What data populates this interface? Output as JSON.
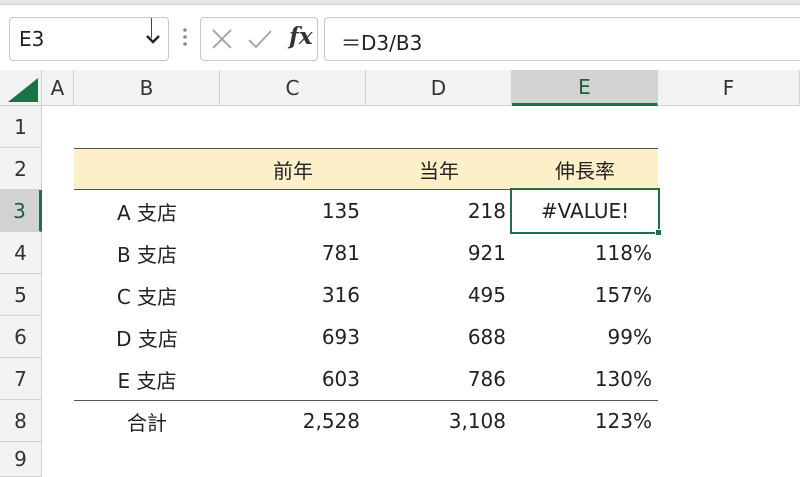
{
  "name_box": {
    "value": "E3"
  },
  "formula_bar": {
    "formula": "＝D3/B3",
    "fx_label": "fx"
  },
  "columns": [
    "A",
    "B",
    "C",
    "D",
    "E",
    "F"
  ],
  "rows": [
    "1",
    "2",
    "3",
    "4",
    "5",
    "6",
    "7",
    "8",
    "9"
  ],
  "selected_cell": "E3",
  "table": {
    "headers": [
      "",
      "前年",
      "当年",
      "伸長率"
    ],
    "rows": [
      [
        "A 支店",
        "135",
        "218",
        "#VALUE!"
      ],
      [
        "B 支店",
        "781",
        "921",
        "118%"
      ],
      [
        "C 支店",
        "316",
        "495",
        "157%"
      ],
      [
        "D 支店",
        "693",
        "688",
        "99%"
      ],
      [
        "E 支店",
        "603",
        "786",
        "130%"
      ]
    ],
    "total": [
      "合計",
      "2,528",
      "3,108",
      "123%"
    ]
  },
  "colors": {
    "header_fill": "#fdf0c8",
    "selection_accent": "#1e7145",
    "header_bg": "#f3f3f3"
  }
}
